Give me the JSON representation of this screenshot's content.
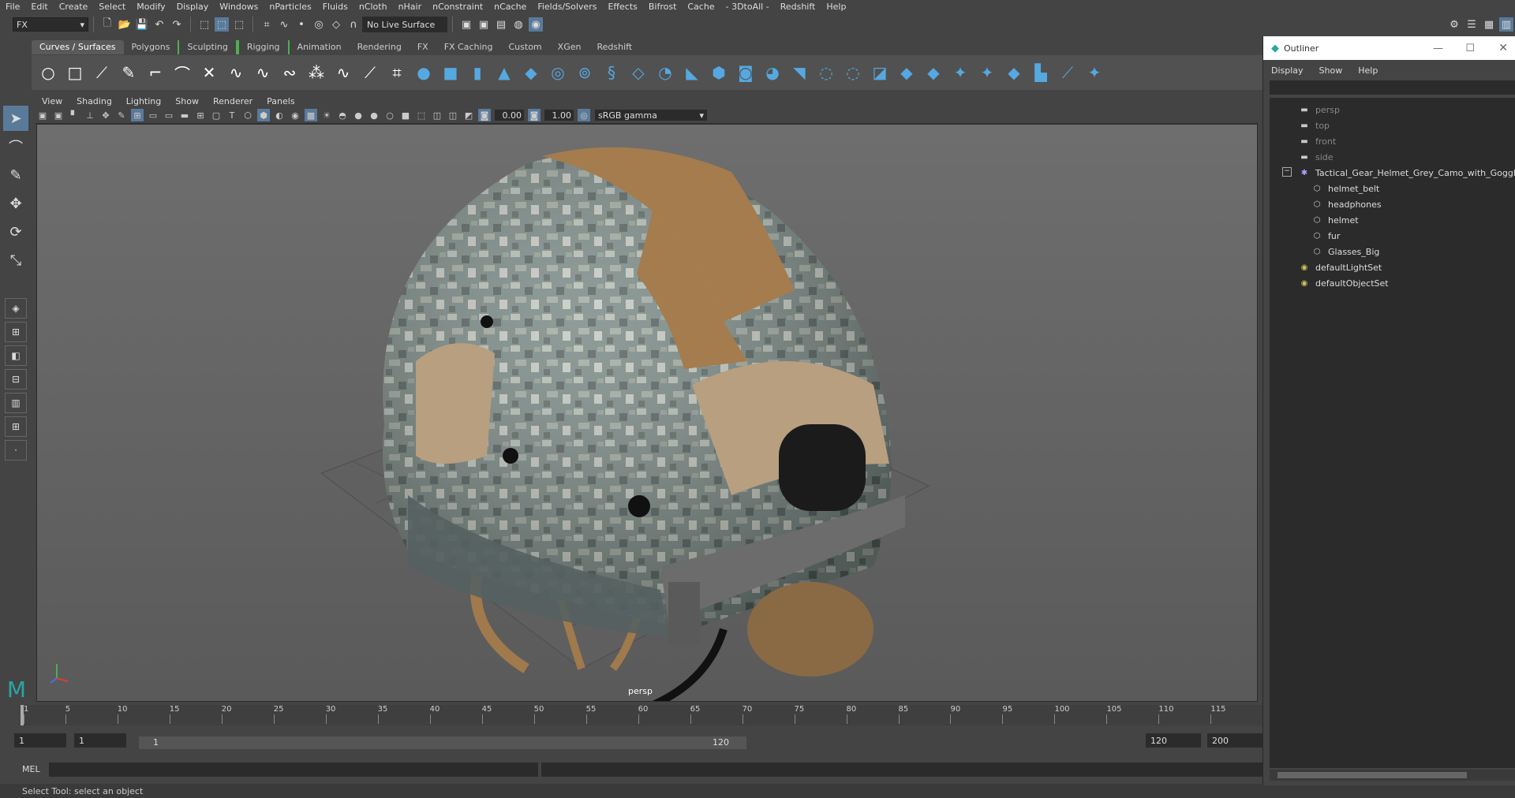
{
  "menubar": [
    "File",
    "Edit",
    "Create",
    "Select",
    "Modify",
    "Display",
    "Windows",
    "nParticles",
    "Fluids",
    "nCloth",
    "nHair",
    "nConstraint",
    "nCache",
    "Fields/Solvers",
    "Effects",
    "Bifrost",
    "Cache",
    "- 3DtoAll -",
    "Redshift",
    "Help"
  ],
  "status": {
    "mode": "FX",
    "live_surface": "No Live Surface"
  },
  "shelf_tabs": [
    "Curves / Surfaces",
    "Polygons",
    "Sculpting",
    "Rigging",
    "Animation",
    "Rendering",
    "FX",
    "FX Caching",
    "Custom",
    "XGen",
    "Redshift"
  ],
  "viewport": {
    "menu": [
      "View",
      "Shading",
      "Lighting",
      "Show",
      "Renderer",
      "Panels"
    ],
    "exposure": "0.00",
    "gamma_value": "1.00",
    "color_space": "sRGB gamma",
    "camera_label": "persp"
  },
  "timeline": {
    "ticks": [
      "1",
      "5",
      "10",
      "15",
      "20",
      "25",
      "30",
      "35",
      "40",
      "45",
      "50",
      "55",
      "60",
      "65",
      "70",
      "75",
      "80",
      "85",
      "90",
      "95",
      "100",
      "105",
      "110",
      "115"
    ],
    "start_frame": "1",
    "current_frame": "1",
    "range_start": "1",
    "range_end": "120",
    "playback_end": "120",
    "anim_end": "200"
  },
  "command": {
    "label": "MEL"
  },
  "help_line": "Select Tool: select an object",
  "outliner": {
    "title": "Outliner",
    "menu": [
      "Display",
      "Show",
      "Help"
    ],
    "items": [
      {
        "label": "persp",
        "type": "camera",
        "dim": true
      },
      {
        "label": "top",
        "type": "camera",
        "dim": true
      },
      {
        "label": "front",
        "type": "camera",
        "dim": true
      },
      {
        "label": "side",
        "type": "camera",
        "dim": true
      },
      {
        "label": "Tactical_Gear_Helmet_Grey_Camo_with_Goggles_",
        "type": "group",
        "dim": false
      },
      {
        "label": "helmet_belt",
        "type": "mesh",
        "dim": false
      },
      {
        "label": "headphones",
        "type": "mesh",
        "dim": false
      },
      {
        "label": "helmet",
        "type": "mesh",
        "dim": false
      },
      {
        "label": "fur",
        "type": "mesh",
        "dim": false
      },
      {
        "label": "Glasses_Big",
        "type": "mesh",
        "dim": false
      },
      {
        "label": "defaultLightSet",
        "type": "set",
        "dim": false
      },
      {
        "label": "defaultObjectSet",
        "type": "set",
        "dim": false
      }
    ]
  },
  "colors": {
    "accent": "#5a7a9a",
    "shelf_blue": "#56a8e0",
    "maya_teal": "#2aa6a6"
  }
}
